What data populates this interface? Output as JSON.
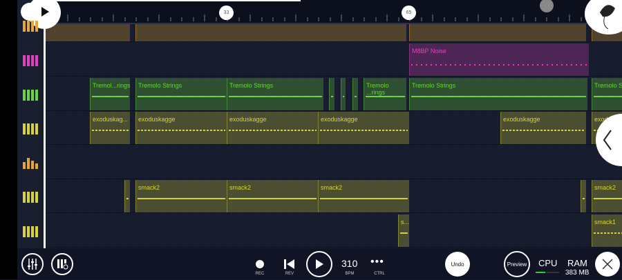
{
  "ruler": {
    "markers": [
      "33",
      "65"
    ]
  },
  "tracks": [
    {
      "color": "#e8a530",
      "icon": "drum-icon",
      "clips": [
        "",
        "",
        "",
        ""
      ]
    },
    {
      "color": "#e040c0",
      "icon": "piano-icon",
      "clips": [
        "M8BP Noise"
      ]
    },
    {
      "color": "#6ad43a",
      "icon": "piano-icon",
      "clips": [
        "Tremol...rings",
        "Tremolo Strings",
        "Tremolo Strings",
        "",
        "",
        "",
        "Tremolo ...rings",
        "Tremolo Strings",
        "Tremolo St"
      ]
    },
    {
      "color": "#d8d23a",
      "icon": "piano-icon",
      "clips": [
        "exoduskag...",
        "exoduskagge",
        "exoduskagge",
        "exoduskagge",
        "exoduskagge",
        "exodusk"
      ]
    },
    {
      "color": "#e8a530",
      "icon": "equalizer-icon",
      "clips": []
    },
    {
      "color": "#d8d23a",
      "icon": "piano-icon",
      "clips": [
        "",
        "smack2",
        "smack2",
        "smack2",
        "",
        "smack2"
      ]
    },
    {
      "color": "#d8d23a",
      "icon": "piano-icon",
      "clips": [
        "s...",
        "smack1"
      ]
    }
  ],
  "transport": {
    "rec": "REC",
    "rev": "REV",
    "bpm_value": "310",
    "bpm": "BPM",
    "ctrl": "CTRL",
    "undo": "Undo",
    "preview": "Preview",
    "cpu": "CPU",
    "ram": "RAM",
    "ram_value": "383 MB",
    "cpu_level": 0.4
  }
}
